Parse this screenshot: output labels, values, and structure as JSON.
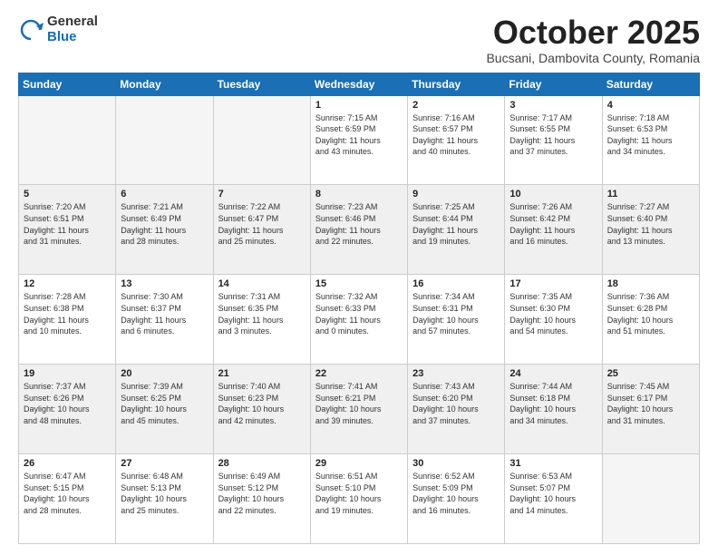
{
  "logo": {
    "general": "General",
    "blue": "Blue"
  },
  "header": {
    "month": "October 2025",
    "location": "Bucsani, Dambovita County, Romania"
  },
  "weekdays": [
    "Sunday",
    "Monday",
    "Tuesday",
    "Wednesday",
    "Thursday",
    "Friday",
    "Saturday"
  ],
  "weeks": [
    [
      {
        "num": "",
        "info": "",
        "empty": true
      },
      {
        "num": "",
        "info": "",
        "empty": true
      },
      {
        "num": "",
        "info": "",
        "empty": true
      },
      {
        "num": "1",
        "info": "Sunrise: 7:15 AM\nSunset: 6:59 PM\nDaylight: 11 hours\nand 43 minutes.",
        "empty": false
      },
      {
        "num": "2",
        "info": "Sunrise: 7:16 AM\nSunset: 6:57 PM\nDaylight: 11 hours\nand 40 minutes.",
        "empty": false
      },
      {
        "num": "3",
        "info": "Sunrise: 7:17 AM\nSunset: 6:55 PM\nDaylight: 11 hours\nand 37 minutes.",
        "empty": false
      },
      {
        "num": "4",
        "info": "Sunrise: 7:18 AM\nSunset: 6:53 PM\nDaylight: 11 hours\nand 34 minutes.",
        "empty": false
      }
    ],
    [
      {
        "num": "5",
        "info": "Sunrise: 7:20 AM\nSunset: 6:51 PM\nDaylight: 11 hours\nand 31 minutes.",
        "empty": false
      },
      {
        "num": "6",
        "info": "Sunrise: 7:21 AM\nSunset: 6:49 PM\nDaylight: 11 hours\nand 28 minutes.",
        "empty": false
      },
      {
        "num": "7",
        "info": "Sunrise: 7:22 AM\nSunset: 6:47 PM\nDaylight: 11 hours\nand 25 minutes.",
        "empty": false
      },
      {
        "num": "8",
        "info": "Sunrise: 7:23 AM\nSunset: 6:46 PM\nDaylight: 11 hours\nand 22 minutes.",
        "empty": false
      },
      {
        "num": "9",
        "info": "Sunrise: 7:25 AM\nSunset: 6:44 PM\nDaylight: 11 hours\nand 19 minutes.",
        "empty": false
      },
      {
        "num": "10",
        "info": "Sunrise: 7:26 AM\nSunset: 6:42 PM\nDaylight: 11 hours\nand 16 minutes.",
        "empty": false
      },
      {
        "num": "11",
        "info": "Sunrise: 7:27 AM\nSunset: 6:40 PM\nDaylight: 11 hours\nand 13 minutes.",
        "empty": false
      }
    ],
    [
      {
        "num": "12",
        "info": "Sunrise: 7:28 AM\nSunset: 6:38 PM\nDaylight: 11 hours\nand 10 minutes.",
        "empty": false
      },
      {
        "num": "13",
        "info": "Sunrise: 7:30 AM\nSunset: 6:37 PM\nDaylight: 11 hours\nand 6 minutes.",
        "empty": false
      },
      {
        "num": "14",
        "info": "Sunrise: 7:31 AM\nSunset: 6:35 PM\nDaylight: 11 hours\nand 3 minutes.",
        "empty": false
      },
      {
        "num": "15",
        "info": "Sunrise: 7:32 AM\nSunset: 6:33 PM\nDaylight: 11 hours\nand 0 minutes.",
        "empty": false
      },
      {
        "num": "16",
        "info": "Sunrise: 7:34 AM\nSunset: 6:31 PM\nDaylight: 10 hours\nand 57 minutes.",
        "empty": false
      },
      {
        "num": "17",
        "info": "Sunrise: 7:35 AM\nSunset: 6:30 PM\nDaylight: 10 hours\nand 54 minutes.",
        "empty": false
      },
      {
        "num": "18",
        "info": "Sunrise: 7:36 AM\nSunset: 6:28 PM\nDaylight: 10 hours\nand 51 minutes.",
        "empty": false
      }
    ],
    [
      {
        "num": "19",
        "info": "Sunrise: 7:37 AM\nSunset: 6:26 PM\nDaylight: 10 hours\nand 48 minutes.",
        "empty": false
      },
      {
        "num": "20",
        "info": "Sunrise: 7:39 AM\nSunset: 6:25 PM\nDaylight: 10 hours\nand 45 minutes.",
        "empty": false
      },
      {
        "num": "21",
        "info": "Sunrise: 7:40 AM\nSunset: 6:23 PM\nDaylight: 10 hours\nand 42 minutes.",
        "empty": false
      },
      {
        "num": "22",
        "info": "Sunrise: 7:41 AM\nSunset: 6:21 PM\nDaylight: 10 hours\nand 39 minutes.",
        "empty": false
      },
      {
        "num": "23",
        "info": "Sunrise: 7:43 AM\nSunset: 6:20 PM\nDaylight: 10 hours\nand 37 minutes.",
        "empty": false
      },
      {
        "num": "24",
        "info": "Sunrise: 7:44 AM\nSunset: 6:18 PM\nDaylight: 10 hours\nand 34 minutes.",
        "empty": false
      },
      {
        "num": "25",
        "info": "Sunrise: 7:45 AM\nSunset: 6:17 PM\nDaylight: 10 hours\nand 31 minutes.",
        "empty": false
      }
    ],
    [
      {
        "num": "26",
        "info": "Sunrise: 6:47 AM\nSunset: 5:15 PM\nDaylight: 10 hours\nand 28 minutes.",
        "empty": false
      },
      {
        "num": "27",
        "info": "Sunrise: 6:48 AM\nSunset: 5:13 PM\nDaylight: 10 hours\nand 25 minutes.",
        "empty": false
      },
      {
        "num": "28",
        "info": "Sunrise: 6:49 AM\nSunset: 5:12 PM\nDaylight: 10 hours\nand 22 minutes.",
        "empty": false
      },
      {
        "num": "29",
        "info": "Sunrise: 6:51 AM\nSunset: 5:10 PM\nDaylight: 10 hours\nand 19 minutes.",
        "empty": false
      },
      {
        "num": "30",
        "info": "Sunrise: 6:52 AM\nSunset: 5:09 PM\nDaylight: 10 hours\nand 16 minutes.",
        "empty": false
      },
      {
        "num": "31",
        "info": "Sunrise: 6:53 AM\nSunset: 5:07 PM\nDaylight: 10 hours\nand 14 minutes.",
        "empty": false
      },
      {
        "num": "",
        "info": "",
        "empty": true
      }
    ]
  ]
}
